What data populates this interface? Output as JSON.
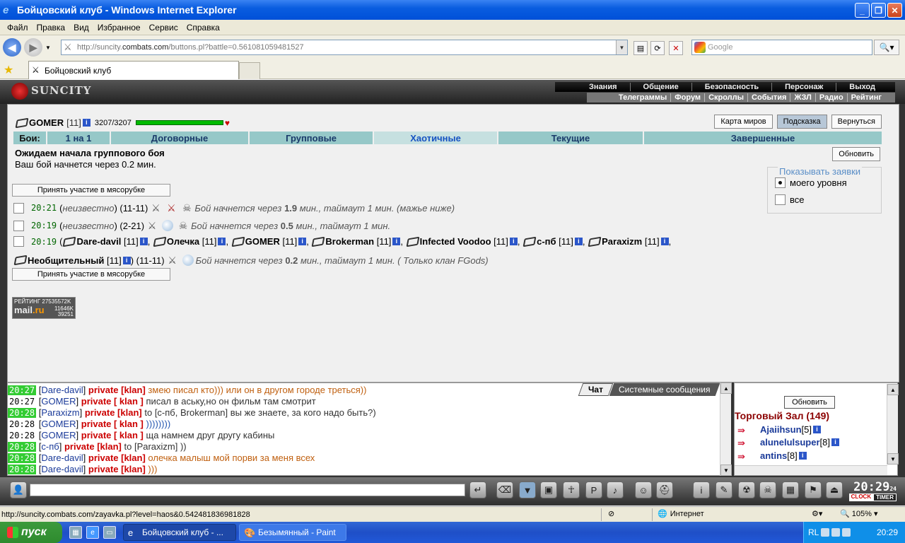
{
  "window": {
    "title": "Бойцовский клуб - Windows Internet Explorer"
  },
  "menu": [
    "Файл",
    "Правка",
    "Вид",
    "Избранное",
    "Сервис",
    "Справка"
  ],
  "address": {
    "prefix": "http://suncity.",
    "domain": "combats.com",
    "path": "/buttons.pl?battle=0.561081059481527"
  },
  "search": {
    "placeholder": "Google"
  },
  "tab": {
    "title": "Бойцовский клуб"
  },
  "site": {
    "logo": "SUNCITY",
    "nav_top": [
      "Знания",
      "Общение",
      "Безопасность",
      "Персонаж",
      "Выход"
    ],
    "nav_bottom": [
      "Телеграммы",
      "Форум",
      "Скроллы",
      "События",
      "ЖЗЛ",
      "Радио",
      "Рейтинг"
    ]
  },
  "player": {
    "name": "GOMER",
    "level": "[11]",
    "hp": "3207/3207",
    "hp_fraction": 1.0
  },
  "top_buttons": [
    "Карта миров",
    "Подсказка",
    "Вернуться"
  ],
  "battle_tabs": {
    "label": "Бои:",
    "items": [
      "1 на 1",
      "Договорные",
      "Групповые",
      "Хаотичные",
      "Текущие",
      "Завершенные"
    ],
    "active": 3
  },
  "status": {
    "line1": "Ожидаем начала группового боя",
    "line2": "Ваш бой начнется через 0.2 мин.",
    "refresh": "Обновить"
  },
  "join_label": "Принять участие в мясорубке",
  "show_filter": {
    "title": "Показывать заявки",
    "opt1": "моего уровня",
    "opt2": "все"
  },
  "battles": [
    {
      "time": "20:21",
      "who": "неизвестно",
      "range": "(11-11)",
      "t1": "Бой начнется через ",
      "n1": "1.9",
      "t2": " мин., таймаут 1 мин. (мажье ниже)"
    },
    {
      "time": "20:19",
      "who": "неизвестно",
      "range": "(2-21)",
      "t1": "Бой начнется через ",
      "n1": "0.5",
      "t2": " мин., таймаут 1 мин."
    }
  ],
  "battle3": {
    "time": "20:19",
    "members": [
      {
        "name": "Dare-davil",
        "lvl": "[11]"
      },
      {
        "name": "Олечка",
        "lvl": "[11]"
      },
      {
        "name": "GOMER",
        "lvl": "[11]"
      },
      {
        "name": "Brokerman",
        "lvl": "[11]"
      },
      {
        "name": "Infected Voodoo",
        "lvl": "[11]"
      },
      {
        "name": "с-пб",
        "lvl": "[11]"
      },
      {
        "name": "Paraxizm",
        "lvl": "[11]"
      },
      {
        "name": "Необщительный",
        "lvl": "[11]"
      }
    ],
    "range": "(11-11)",
    "t1": "Бой начнется через ",
    "n1": "0.2",
    "t2": " мин., таймаут 1 мин. ( Только клан FGods)"
  },
  "counter": {
    "top": "РЕЙТИНГ 27535572K",
    "logo_a": "mail",
    "logo_b": ".ru",
    "n1": "11646K",
    "n2": "39251"
  },
  "chat_tabs": [
    "Чат",
    "Системные сообщения"
  ],
  "chat": [
    {
      "time": "20:27",
      "hl": true,
      "nick": "Dare-davil",
      "pv": "private [klan]",
      "msg": "змею писал кто))) или он в другом городе треться))",
      "c": "o"
    },
    {
      "time": "20:27",
      "hl": false,
      "nick": "GOMER",
      "pv": "private [ klan ]",
      "msg": "писал в аську,но он фильм там смотрит",
      "c": "k"
    },
    {
      "time": "20:28",
      "hl": true,
      "nick": "Paraxizm",
      "pv": "private [klan]",
      "msg": "to [с-пб, Brokerman] вы же знаете, за кого надо быть?)",
      "c": "k"
    },
    {
      "time": "20:28",
      "hl": false,
      "nick": "GOMER",
      "pv": "private [ klan ]",
      "msg": "))))))))",
      "c": "b"
    },
    {
      "time": "20:28",
      "hl": false,
      "nick": "GOMER",
      "pv": "private [ klan ]",
      "msg": "ща намнем друг другу кабины",
      "c": "k"
    },
    {
      "time": "20:28",
      "hl": true,
      "nick": "с-пб",
      "pv": "private [klan]",
      "msg": "to [Paraxizm] ))",
      "c": "k"
    },
    {
      "time": "20:28",
      "hl": true,
      "nick": "Dare-davil",
      "pv": "private [klan]",
      "msg": "олечка малыш мой порви за меня всех",
      "c": "o"
    },
    {
      "time": "20:28",
      "hl": true,
      "nick": "Dare-davil",
      "pv": "private [klan]",
      "msg": ")))",
      "c": "o"
    }
  ],
  "room": {
    "refresh": "Обновить",
    "title": "Торговый Зал (149)",
    "users": [
      {
        "name": "Ajaiihsun",
        "lvl": "[5]"
      },
      {
        "name": "alunelulsuper",
        "lvl": "[8]"
      },
      {
        "name": "antins",
        "lvl": "[8]"
      }
    ]
  },
  "clock": {
    "time": "20:29",
    "sec": "24",
    "l1": "CLOCK",
    "l2": "TIMER"
  },
  "statusbar": {
    "url": "http://suncity.combats.com/zayavka.pl?level=haos&0.542481836981828",
    "zone": "Интернет",
    "zoom": "105%"
  },
  "taskbar": {
    "start": "пуск",
    "task1": "Бойцовский клуб - ...",
    "task2": "Безымянный - Paint",
    "lang": "RL",
    "time": "20:29"
  }
}
